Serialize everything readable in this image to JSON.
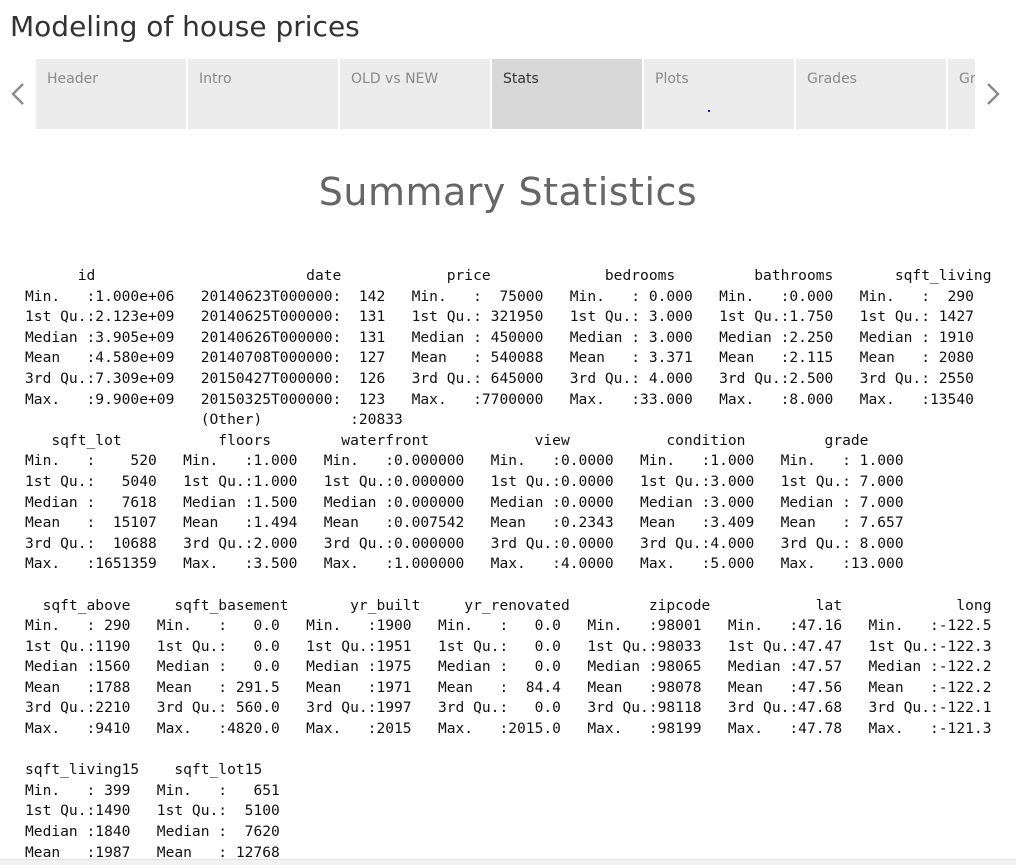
{
  "page": {
    "title": "Modeling of house prices"
  },
  "tabs": [
    {
      "label": "Header"
    },
    {
      "label": "Intro"
    },
    {
      "label": "OLD vs NEW"
    },
    {
      "label": "Stats"
    },
    {
      "label": "Plots"
    },
    {
      "label": "Grades"
    },
    {
      "label": "Gr"
    }
  ],
  "active_tab": "Stats",
  "icons": {
    "prev": "chevron-left-icon",
    "next": "chevron-right-icon"
  },
  "colors": {
    "tab_bg": "#ececec",
    "tab_active_bg": "#d8d8d8",
    "tab_text": "#8a8a8a",
    "heading": "#666666"
  },
  "main": {
    "heading": "Summary Statistics",
    "summary_lines": [
      "      id                        date            price             bedrooms         bathrooms       sqft_living",
      "Min.   :1.000e+06   20140623T000000:  142   Min.   :  75000   Min.   : 0.000   Min.   :0.000   Min.   :  290",
      "1st Qu.:2.123e+09   20140625T000000:  131   1st Qu.: 321950   1st Qu.: 3.000   1st Qu.:1.750   1st Qu.: 1427",
      "Median :3.905e+09   20140626T000000:  131   Median : 450000   Median : 3.000   Median :2.250   Median : 1910",
      "Mean   :4.580e+09   20140708T000000:  127   Mean   : 540088   Mean   : 3.371   Mean   :2.115   Mean   : 2080",
      "3rd Qu.:7.309e+09   20150427T000000:  126   3rd Qu.: 645000   3rd Qu.: 4.000   3rd Qu.:2.500   3rd Qu.: 2550",
      "Max.   :9.900e+09   20150325T000000:  123   Max.   :7700000   Max.   :33.000   Max.   :8.000   Max.   :13540",
      "                    (Other)          :20833",
      "   sqft_lot           floors        waterfront            view           condition         grade",
      "Min.   :    520   Min.   :1.000   Min.   :0.000000   Min.   :0.0000   Min.   :1.000   Min.   : 1.000",
      "1st Qu.:   5040   1st Qu.:1.000   1st Qu.:0.000000   1st Qu.:0.0000   1st Qu.:3.000   1st Qu.: 7.000",
      "Median :   7618   Median :1.500   Median :0.000000   Median :0.0000   Median :3.000   Median : 7.000",
      "Mean   :  15107   Mean   :1.494   Mean   :0.007542   Mean   :0.2343   Mean   :3.409   Mean   : 7.657",
      "3rd Qu.:  10688   3rd Qu.:2.000   3rd Qu.:0.000000   3rd Qu.:0.0000   3rd Qu.:4.000   3rd Qu.: 8.000",
      "Max.   :1651359   Max.   :3.500   Max.   :1.000000   Max.   :4.0000   Max.   :5.000   Max.   :13.000",
      "",
      "  sqft_above     sqft_basement       yr_built     yr_renovated         zipcode            lat             long",
      "Min.   : 290   Min.   :   0.0   Min.   :1900   Min.   :   0.0   Min.   :98001   Min.   :47.16   Min.   :-122.5",
      "1st Qu.:1190   1st Qu.:   0.0   1st Qu.:1951   1st Qu.:   0.0   1st Qu.:98033   1st Qu.:47.47   1st Qu.:-122.3",
      "Median :1560   Median :   0.0   Median :1975   Median :   0.0   Median :98065   Median :47.57   Median :-122.2",
      "Mean   :1788   Mean   : 291.5   Mean   :1971   Mean   :  84.4   Mean   :98078   Mean   :47.56   Mean   :-122.2",
      "3rd Qu.:2210   3rd Qu.: 560.0   3rd Qu.:1997   3rd Qu.:   0.0   3rd Qu.:98118   3rd Qu.:47.68   3rd Qu.:-122.1",
      "Max.   :9410   Max.   :4820.0   Max.   :2015   Max.   :2015.0   Max.   :98199   Max.   :47.78   Max.   :-121.3",
      "",
      "sqft_living15    sqft_lot15",
      "Min.   : 399   Min.   :   651",
      "1st Qu.:1490   1st Qu.:  5100",
      "Median :1840   Median :  7620",
      "Mean   :1987   Mean   : 12768"
    ]
  }
}
